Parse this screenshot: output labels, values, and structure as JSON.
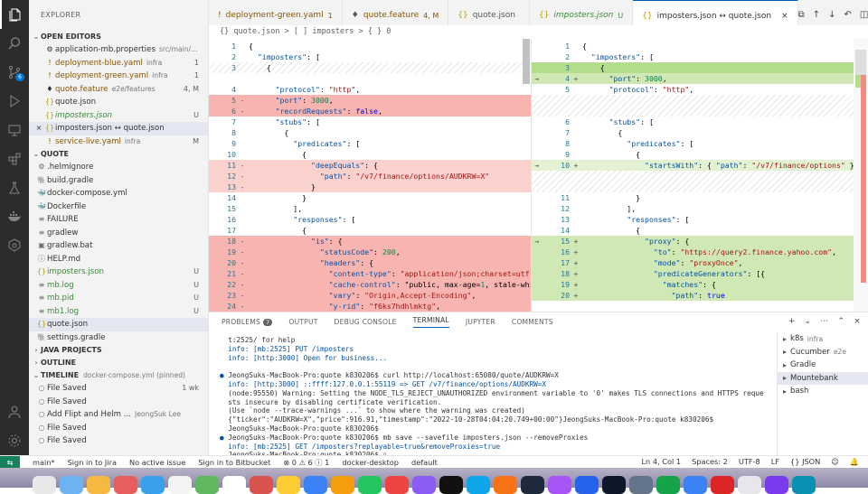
{
  "activity": [
    {
      "name": "files-icon",
      "glyph": "files"
    },
    {
      "name": "search-icon"
    },
    {
      "name": "source-control-icon",
      "badge": "6"
    },
    {
      "name": "run-debug-icon"
    },
    {
      "name": "remote-explorer-icon"
    },
    {
      "name": "extensions-icon"
    },
    {
      "name": "testing-icon"
    },
    {
      "name": "docker-icon"
    },
    {
      "name": "kubernetes-icon"
    }
  ],
  "sidebar": {
    "title": "EXPLORER",
    "open_editors_label": "OPEN EDITORS",
    "open_editors": [
      {
        "icon": "⚙",
        "name": "application-mb.properties",
        "sub": "src/main/re...",
        "status": "",
        "cls": ""
      },
      {
        "icon": "!",
        "name": "deployment-blue.yaml",
        "sub": "infra",
        "status": "1",
        "cls": "y"
      },
      {
        "icon": "!",
        "name": "deployment-green.yaml",
        "sub": "infra",
        "status": "1",
        "cls": "y"
      },
      {
        "icon": "♦",
        "name": "quote.feature",
        "sub": "e2e/features",
        "status": "4, M",
        "cls": "y"
      },
      {
        "icon": "{}",
        "name": "quote.json",
        "sub": "",
        "status": "",
        "cls": ""
      },
      {
        "icon": "{}",
        "name": "imposters.json",
        "sub": "",
        "status": "U",
        "cls": "g",
        "italic": true
      },
      {
        "icon": "{}",
        "name": "imposters.json ↔ quote.json",
        "sub": "",
        "status": "",
        "cls": "",
        "close": true,
        "sel": true
      },
      {
        "icon": "!",
        "name": "service-live.yaml",
        "sub": "infra",
        "status": "M",
        "cls": "y"
      }
    ],
    "project_label": "QUOTE",
    "files": [
      {
        "icon": "⚙",
        "name": ".helmignore",
        "status": "",
        "cls": ""
      },
      {
        "icon": "🐘",
        "name": "build.gradle",
        "status": "",
        "cls": ""
      },
      {
        "icon": "🐳",
        "name": "docker-compose.yml",
        "status": "",
        "cls": ""
      },
      {
        "icon": "🐳",
        "name": "Dockerfile",
        "status": "",
        "cls": ""
      },
      {
        "icon": "≡",
        "name": "FAILURE",
        "status": "",
        "cls": ""
      },
      {
        "icon": "≡",
        "name": "gradlew",
        "status": "",
        "cls": ""
      },
      {
        "icon": "▣",
        "name": "gradlew.bat",
        "status": "",
        "cls": ""
      },
      {
        "icon": "ⓘ",
        "name": "HELP.md",
        "status": "",
        "cls": ""
      },
      {
        "icon": "{}",
        "name": "imposters.json",
        "status": "U",
        "cls": "g"
      },
      {
        "icon": "≡",
        "name": "mb.log",
        "status": "U",
        "cls": "g"
      },
      {
        "icon": "≡",
        "name": "mb.pid",
        "status": "U",
        "cls": "g"
      },
      {
        "icon": "≡",
        "name": "mb1.log",
        "status": "U",
        "cls": "g"
      },
      {
        "icon": "{}",
        "name": "quote.json",
        "status": "",
        "cls": "",
        "sel": true
      },
      {
        "icon": "🐘",
        "name": "settings.gradle",
        "status": "",
        "cls": ""
      }
    ],
    "java_projects_label": "JAVA PROJECTS",
    "outline_label": "OUTLINE",
    "timeline_label": "TIMELINE",
    "timeline_sub": "docker-compose.yml (pinned)",
    "timeline": [
      {
        "name": "File Saved",
        "right": "1 wk"
      },
      {
        "name": "File Saved",
        "right": ""
      },
      {
        "name": "Add Flipt and Helm ...",
        "sub": "JeongSuk Lee",
        "right": ""
      },
      {
        "name": "File Saved",
        "right": ""
      },
      {
        "name": "File Saved",
        "right": ""
      }
    ]
  },
  "tabs": [
    {
      "icon": "!",
      "label": "deployment-green.yaml",
      "status": "1",
      "cls": "y"
    },
    {
      "icon": "♦",
      "label": "quote.feature",
      "status": "4, M",
      "cls": "y"
    },
    {
      "icon": "{}",
      "label": "quote.json",
      "status": "",
      "cls": ""
    },
    {
      "icon": "{}",
      "label": "imposters.json",
      "status": "U",
      "cls": "g",
      "italic": true
    },
    {
      "icon": "{}",
      "label": "imposters.json ↔ quote.json",
      "status": "",
      "cls": "",
      "active": true,
      "close": true
    }
  ],
  "breadcrumb": "{} quote.json > [ ] imposters > { } 0",
  "diff_left": [
    {
      "n": "1",
      "t": "{",
      "bg": ""
    },
    {
      "n": "2",
      "t": "  \"imposters\": [",
      "bg": ""
    },
    {
      "n": "3",
      "t": "    {",
      "bg": ""
    },
    {
      "gap": true
    },
    {
      "n": "4",
      "t": "      \"protocol\": \"http\",",
      "bg": ""
    },
    {
      "n": "5",
      "t": "      \"port\": 3000,",
      "bg": "del",
      "mk": "-"
    },
    {
      "n": "6",
      "t": "      \"recordRequests\": false,",
      "bg": "del",
      "mk": "-"
    },
    {
      "n": "7",
      "t": "      \"stubs\": [",
      "bg": ""
    },
    {
      "n": "8",
      "t": "        {",
      "bg": ""
    },
    {
      "n": "9",
      "t": "          \"predicates\": [",
      "bg": ""
    },
    {
      "n": "10",
      "t": "            {",
      "bg": ""
    },
    {
      "n": "11",
      "t": "              \"deepEquals\": {",
      "bg": "delS",
      "mk": "-"
    },
    {
      "n": "12",
      "t": "                \"path\": \"/v7/finance/options/AUDKRW=X\"",
      "bg": "delS",
      "mk": "-"
    },
    {
      "n": "13",
      "t": "              }",
      "bg": "delS",
      "mk": "-"
    },
    {
      "n": "14",
      "t": "            }",
      "bg": ""
    },
    {
      "n": "15",
      "t": "          ],",
      "bg": ""
    },
    {
      "n": "16",
      "t": "          \"responses\": [",
      "bg": ""
    },
    {
      "n": "17",
      "t": "            {",
      "bg": ""
    },
    {
      "n": "18",
      "t": "              \"is\": {",
      "bg": "del",
      "mk": "-"
    },
    {
      "n": "19",
      "t": "                \"statusCode\": 200,",
      "bg": "del",
      "mk": "-"
    },
    {
      "n": "20",
      "t": "                \"headers\": {",
      "bg": "del",
      "mk": "-"
    },
    {
      "n": "21",
      "t": "                  \"content-type\": \"application/json;charset=utf-8\"",
      "bg": "del",
      "mk": "-"
    },
    {
      "n": "22",
      "t": "                  \"cache-control\": \"public, max-age=1, stale-while",
      "bg": "del",
      "mk": "-"
    },
    {
      "n": "23",
      "t": "                  \"vary\": \"Origin,Accept-Encoding\",",
      "bg": "del",
      "mk": "-"
    },
    {
      "n": "24",
      "t": "                  \"y-rid\": \"f6ks7hdhlmktg\",",
      "bg": "del",
      "mk": "-"
    }
  ],
  "diff_right": [
    {
      "n": "1",
      "t": "{",
      "bg": ""
    },
    {
      "n": "2",
      "t": "  \"imposters\": [",
      "bg": ""
    },
    {
      "n": "3",
      "t": "    {",
      "bg": "addW"
    },
    {
      "n": "4",
      "t": "      \"port\": 3000,",
      "bg": "add",
      "mk": "+",
      "arr": "→"
    },
    {
      "n": "5",
      "t": "      \"protocol\": \"http\",",
      "bg": ""
    },
    {
      "hatch": true,
      "h": 2
    },
    {
      "n": "6",
      "t": "      \"stubs\": [",
      "bg": ""
    },
    {
      "n": "7",
      "t": "        {",
      "bg": ""
    },
    {
      "n": "8",
      "t": "          \"predicates\": [",
      "bg": ""
    },
    {
      "n": "9",
      "t": "            {",
      "bg": ""
    },
    {
      "n": "10",
      "t": "              \"startsWith\": { \"path\": \"/v7/finance/options\" }",
      "bg": "addS",
      "mk": "+",
      "arr": "→"
    },
    {
      "hatch": true,
      "h": 2
    },
    {
      "n": "11",
      "t": "            }",
      "bg": ""
    },
    {
      "n": "12",
      "t": "          ],",
      "bg": ""
    },
    {
      "n": "13",
      "t": "          \"responses\": [",
      "bg": ""
    },
    {
      "n": "14",
      "t": "            {",
      "bg": ""
    },
    {
      "n": "15",
      "t": "              \"proxy\": {",
      "bg": "add",
      "mk": "+",
      "arr": "→"
    },
    {
      "n": "16",
      "t": "                \"to\": \"https://query2.finance.yahoo.com\",",
      "bg": "add",
      "mk": "+"
    },
    {
      "n": "17",
      "t": "                \"mode\": \"proxyOnce\",",
      "bg": "add",
      "mk": "+"
    },
    {
      "n": "18",
      "t": "                \"predicateGenerators\": [{",
      "bg": "add",
      "mk": "+"
    },
    {
      "n": "19",
      "t": "                  \"matches\": {",
      "bg": "add",
      "mk": "+"
    },
    {
      "n": "20",
      "t": "                    \"path\": true",
      "bg": "add",
      "mk": "+"
    }
  ],
  "panel": {
    "tabs": [
      {
        "label": "PROBLEMS",
        "count": "7"
      },
      {
        "label": "OUTPUT"
      },
      {
        "label": "DEBUG CONSOLE"
      },
      {
        "label": "TERMINAL",
        "active": true
      },
      {
        "label": "JUPYTER"
      },
      {
        "label": "COMMENTS"
      }
    ],
    "terminal": [
      {
        "t": "t:2525/ for help"
      },
      {
        "t": "info: [mb:2525] PUT /imposters"
      },
      {
        "t": "info: [http:3000] Open for business..."
      },
      {
        "t": ""
      },
      {
        "t": "JeongSuks-MacBook-Pro:quote k830206$ curl http://localhost:65080/quote/AUDKRW=X",
        "dot": true
      },
      {
        "t": "info: [http:3000] ::ffff:127.0.0.1:55119 => GET /v7/finance/options/AUDKRW=X"
      },
      {
        "t": "(node:95550) Warning: Setting the NODE_TLS_REJECT_UNAUTHORIZED environment variable to '0' makes TLS connections and HTTPS reque"
      },
      {
        "t": "sts insecure by disabling certificate verification."
      },
      {
        "t": "(Use `node --trace-warnings ...` to show where the warning was created)"
      },
      {
        "t": "{\"ticker\":\"AUDKRW=X\",\"price\":916.91,\"timestamp\":\"2022-10-28T04:04:20.749+00:00\"}JeongSuks-MacBook-Pro:quote k830206$"
      },
      {
        "t": "JeongSuks-MacBook-Pro:quote k830206$"
      },
      {
        "t": "JeongSuks-MacBook-Pro:quote k830206$ mb save --savefile imposters.json --removeProxies",
        "dot": true
      },
      {
        "t": "info: [mb:2525] GET /imposters?replayable=true&removeProxies=true"
      },
      {
        "t": "JeongSuks-MacBook-Pro:quote k830206$ ▯"
      }
    ],
    "terminals": [
      {
        "label": "k8s",
        "sub": "infra"
      },
      {
        "label": "Cucumber",
        "sub": "e2e"
      },
      {
        "label": "Gradle",
        "sub": ""
      },
      {
        "label": "Mountebank",
        "sub": "",
        "sel": true
      },
      {
        "label": "bash",
        "sub": ""
      }
    ]
  },
  "status": {
    "remote": "⇆",
    "branch": "main*",
    "jira": "Sign in to Jira",
    "issue": "No active issue",
    "bitbucket": "Sign in to Bitbucket",
    "problems": "⊗ 0 ⚠ 6 ⓘ 1",
    "docker": "docker-desktop",
    "ns": "default",
    "pos": "Ln 4, Col 1",
    "spaces": "Spaces: 2",
    "enc": "UTF-8",
    "eol": "LF",
    "lang": "{} JSON"
  },
  "colors": {
    "accent": "#005fb8",
    "deleted": "#f8b4b0",
    "added": "#cfe8b4",
    "remote": "#16825d"
  }
}
